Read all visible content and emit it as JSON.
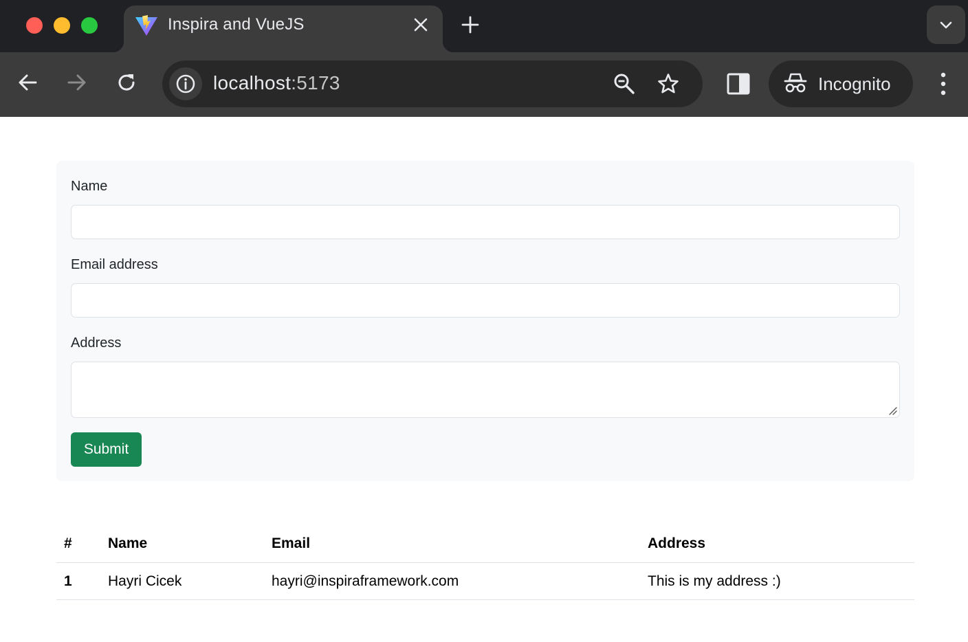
{
  "browser": {
    "tab": {
      "title": "Inspira and VueJS",
      "favicon": "vite-logo-icon"
    },
    "url": {
      "host": "localhost",
      "port": ":5173"
    },
    "incognito_label": "Incognito"
  },
  "form": {
    "name_label": "Name",
    "name_value": "",
    "email_label": "Email address",
    "email_value": "",
    "address_label": "Address",
    "address_value": "",
    "submit_label": "Submit",
    "submit_color": "#198754"
  },
  "table": {
    "headers": [
      "#",
      "Name",
      "Email",
      "Address"
    ],
    "rows": [
      {
        "index": "1",
        "name": "Hayri Cicek",
        "email": "hayri@inspiraframework.com",
        "address": "This is my address :)"
      }
    ]
  },
  "colors": {
    "chrome_dark": "#202124",
    "toolbar": "#3c3c3c",
    "card_bg": "#f8f9fa",
    "border": "#dee2e6"
  }
}
